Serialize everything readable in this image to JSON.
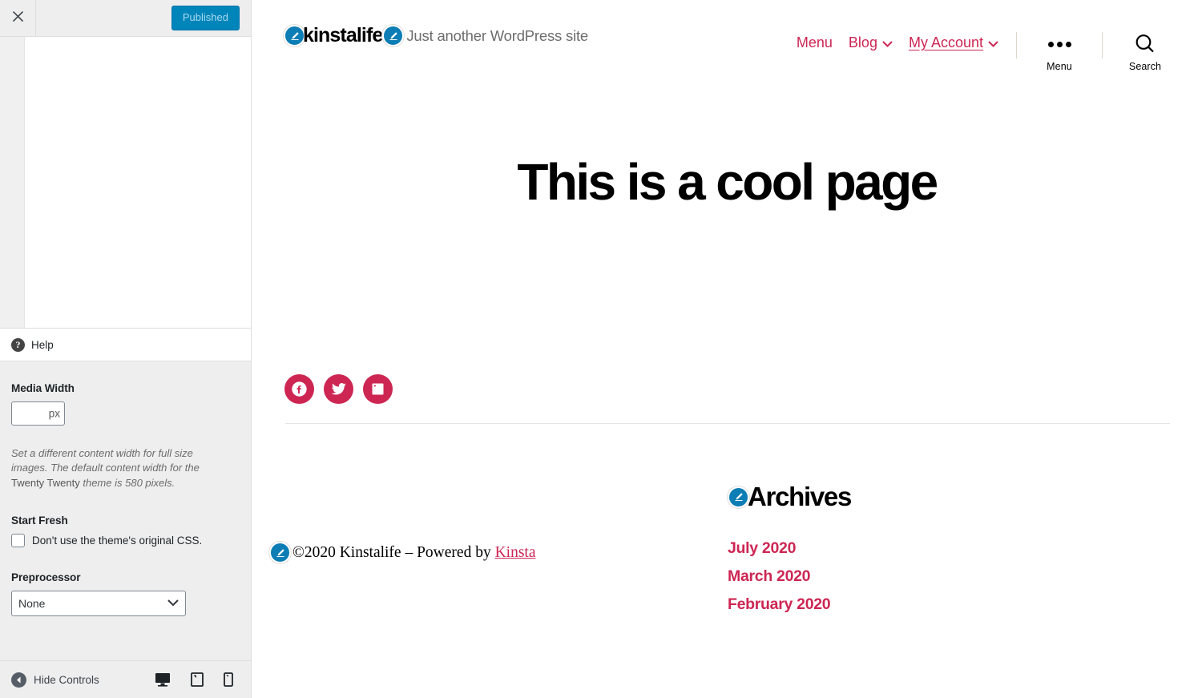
{
  "customizer": {
    "close_icon": "close-icon",
    "publish_label": "Published",
    "css_code": "",
    "help_label": "Help",
    "media_width": {
      "label": "Media Width",
      "value": "",
      "suffix": "px",
      "description_1": "Set a different content width for full size images. The default content width for the ",
      "theme_name": "Twenty Twenty",
      "description_2": " theme is 580 pixels."
    },
    "start_fresh": {
      "label": "Start Fresh",
      "checkbox_label": "Don't use the theme's original CSS.",
      "checked": false
    },
    "preprocessor": {
      "label": "Preprocessor",
      "selected": "None",
      "options": [
        "None"
      ]
    },
    "footer": {
      "hide_controls_label": "Hide Controls",
      "devices": [
        "desktop",
        "tablet",
        "mobile"
      ],
      "active_device": "desktop"
    }
  },
  "site": {
    "title": "kinstalife",
    "tagline": "Just another WordPress site",
    "nav": [
      {
        "label": "Menu",
        "has_chevron": false,
        "hovered": false
      },
      {
        "label": "Blog",
        "has_chevron": true,
        "hovered": false
      },
      {
        "label": "My Account",
        "has_chevron": true,
        "hovered": true
      }
    ],
    "tools": [
      {
        "label": "Menu",
        "icon": "three-dots-icon"
      },
      {
        "label": "Search",
        "icon": "search-icon"
      }
    ],
    "page_title": "This is a cool page",
    "social": [
      {
        "name": "facebook",
        "label": "Facebook"
      },
      {
        "name": "twitter",
        "label": "Twitter"
      },
      {
        "name": "linkedin",
        "label": "LinkedIn"
      }
    ],
    "footer": {
      "copyright_prefix": "©2020 Kinstalife – Powered by ",
      "copyright_link": "Kinsta"
    },
    "widget": {
      "title": "Archives",
      "items": [
        "July 2020",
        "March 2020",
        "February 2020"
      ]
    }
  },
  "colors": {
    "accent": "#cd2653",
    "wp_blue": "#0085ba",
    "edit_pin": "#0c7db5",
    "panel_bg": "#eeeeee"
  }
}
